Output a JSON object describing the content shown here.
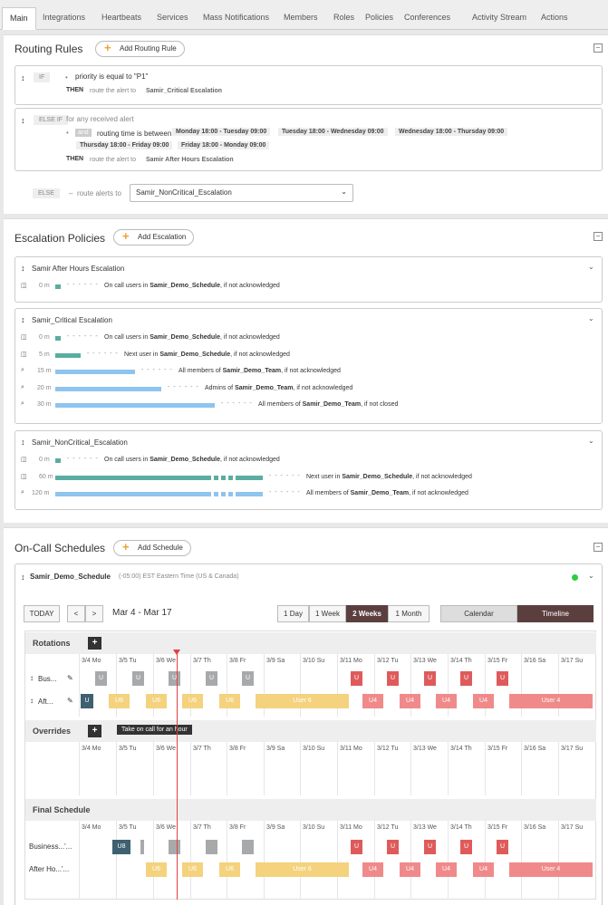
{
  "tabs": [
    "Main",
    "Integrations",
    "Heartbeats",
    "Services",
    "Mass Notifications",
    "Members",
    "Roles",
    "Policies",
    "Conferences",
    "Activity Stream",
    "Actions"
  ],
  "routing": {
    "title": "Routing Rules",
    "add_label": "Add Routing Rule",
    "rule1": {
      "badge": "IF",
      "condition": "priority is equal to \"P1\"",
      "then": "THEN",
      "action": "route the alert to",
      "target": "Samir_Critical Escalation"
    },
    "rule2": {
      "badge": "ELSE IF",
      "desc": "for any received alert",
      "and": "and",
      "condition": "routing time is between",
      "times": [
        "Monday 18:00 - Tuesday 09:00",
        "Tuesday 18:00 - Wednesday 09:00",
        "Wednesday 18:00 - Thursday 09:00",
        "Thursday 18:00 - Friday 09:00",
        "Friday 18:00 - Monday 09:00"
      ],
      "then": "THEN",
      "action": "route the alert to",
      "target": "Samir After Hours Escalation"
    },
    "else": {
      "badge": "ELSE",
      "action": "route alerts to",
      "selected": "Samir_NonCritical_Escalation"
    }
  },
  "escalation": {
    "title": "Escalation Policies",
    "add_label": "Add Escalation",
    "policies": [
      {
        "name": "Samir After Hours Escalation",
        "steps": [
          {
            "time": "0 m",
            "pre": "On call users in",
            "who": "Samir_Demo_Schedule",
            "post": ", if not acknowledged"
          }
        ]
      },
      {
        "name": "Samir_Critical Escalation",
        "steps": [
          {
            "time": "0 m",
            "pre": "On call users in",
            "who": "Samir_Demo_Schedule",
            "post": ", if not acknowledged"
          },
          {
            "time": "5 m",
            "pre": "Next user in",
            "who": "Samir_Demo_Schedule",
            "post": ", if not acknowledged"
          },
          {
            "time": "15 m",
            "pre": "All members of",
            "who": "Samir_Demo_Team",
            "post": ", if not acknowledged"
          },
          {
            "time": "20 m",
            "pre": "Admins of",
            "who": "Samir_Demo_Team",
            "post": ", if not acknowledged"
          },
          {
            "time": "30 m",
            "pre": "All members of",
            "who": "Samir_Demo_Team",
            "post": ", if not closed"
          }
        ]
      },
      {
        "name": "Samir_NonCritical_Escalation",
        "steps": [
          {
            "time": "0 m",
            "pre": "On call users in",
            "who": "Samir_Demo_Schedule",
            "post": ", if not acknowledged"
          },
          {
            "time": "60 m",
            "pre": "Next user in",
            "who": "Samir_Demo_Schedule",
            "post": ", if not acknowledged"
          },
          {
            "time": "120 m",
            "pre": "All members of",
            "who": "Samir_Demo_Team",
            "post": ", if not acknowledged"
          }
        ]
      }
    ]
  },
  "oncall": {
    "title": "On-Call Schedules",
    "add_label": "Add Schedule",
    "schedule_name": "Samir_Demo_Schedule",
    "timezone": "(-05:00) EST Eastern Time (US & Canada)",
    "today": "TODAY",
    "prev": "<",
    "next": ">",
    "range": "Mar 4 - Mar 17",
    "views": [
      "1 Day",
      "1 Week",
      "2 Weeks",
      "1 Month"
    ],
    "modes": [
      "Calendar",
      "Timeline"
    ],
    "status_color": "#2ecc40",
    "days": [
      "3/4 Mo",
      "3/5 Tu",
      "3/6 We",
      "3/7 Th",
      "3/8 Fr",
      "3/9 Sa",
      "3/10 Su",
      "3/11 Mo",
      "3/12 Tu",
      "3/13 We",
      "3/14 Th",
      "3/15 Fr",
      "3/16 Sa",
      "3/17 Su"
    ],
    "rotations_label": "Rotations",
    "overrides_label": "Overrides",
    "final_label": "Final Schedule",
    "rotation_rows": [
      "Bus...",
      "Aft..."
    ],
    "final_rows": [
      "Business...'...",
      "After Ho...'..."
    ],
    "tooltip": "Take on call for an hour",
    "blocks": {
      "u": "U",
      "u6": "U6",
      "user6": "User 6",
      "u4": "U4",
      "user4": "User 4",
      "u8": "U8"
    }
  }
}
